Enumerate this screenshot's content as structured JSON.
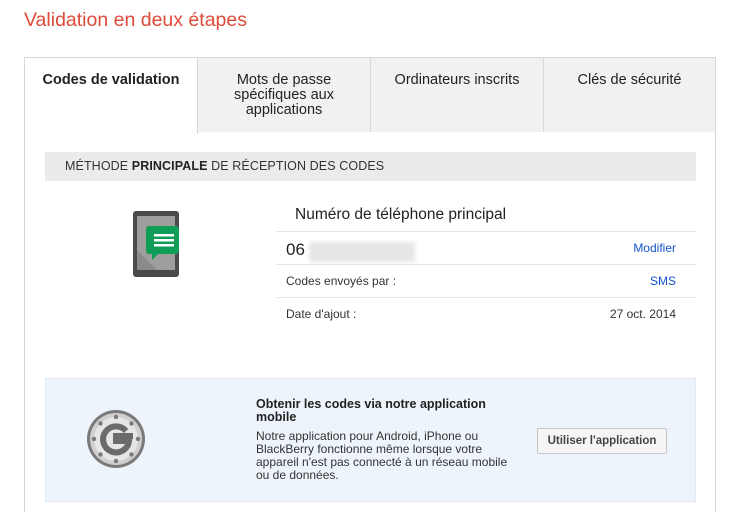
{
  "page": {
    "title": "Validation en deux étapes"
  },
  "tabs": [
    {
      "label": "Codes de validation",
      "active": true
    },
    {
      "label": "Mots de passe spécifiques aux applications",
      "active": false
    },
    {
      "label": "Ordinateurs inscrits",
      "active": false
    },
    {
      "label": "Clés de sécurité",
      "active": false
    }
  ],
  "section": {
    "header_prefix": "MÉTHODE ",
    "header_bold": "PRINCIPALE",
    "header_suffix": " DE RÉCEPTION DES CODES"
  },
  "phone": {
    "title": "Numéro de téléphone principal",
    "number_prefix": "06",
    "modify_label": "Modifier",
    "sent_via_label": "Codes envoyés par :",
    "sent_via_value": "SMS",
    "added_label": "Date d'ajout :",
    "added_value": "27 oct. 2014",
    "icon": "smartphone-message-icon"
  },
  "app": {
    "title": "Obtenir les codes via notre application mobile",
    "description": "Notre application pour Android, iPhone ou BlackBerry fonctionne même lorsque votre appareil n'est pas connecté à un réseau mobile ou de données.",
    "button_label": "Utiliser l'application",
    "icon": "authenticator-icon"
  },
  "colors": {
    "title_red": "#dd4b39",
    "link_blue": "#1155cc",
    "message_green": "#0f9d58"
  }
}
